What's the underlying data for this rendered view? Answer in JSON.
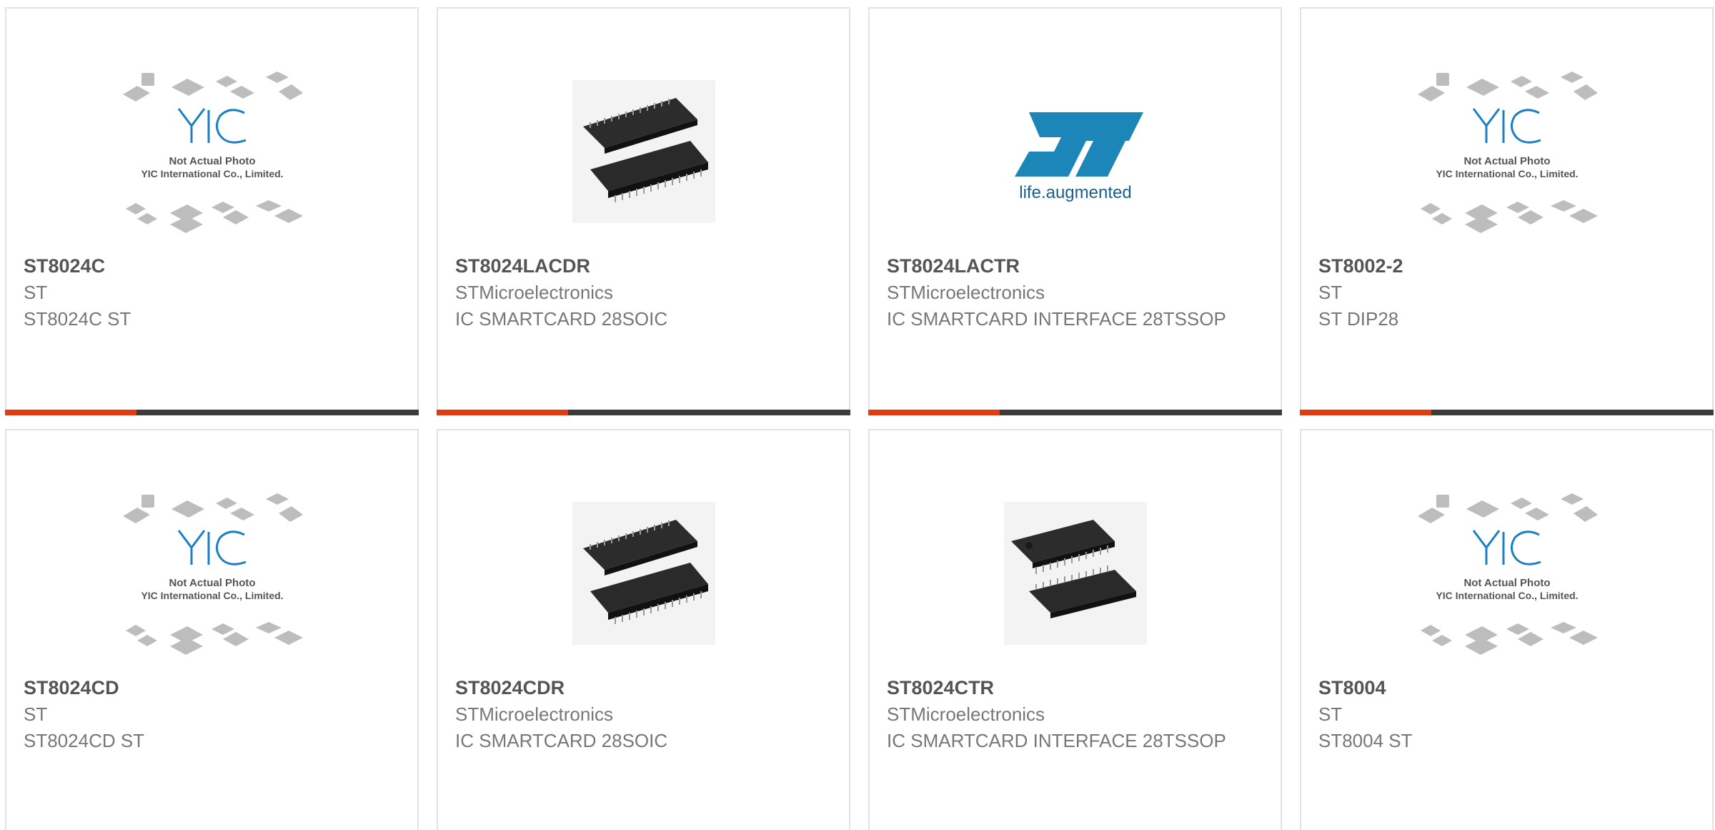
{
  "cards": [
    {
      "part": "ST8024C",
      "maker": "ST",
      "desc": "ST8024C ST",
      "image": "yic-placeholder"
    },
    {
      "part": "ST8024LACDR",
      "maker": "STMicroelectronics",
      "desc": "IC SMARTCARD 28SOIC",
      "image": "soic-chip-photo"
    },
    {
      "part": "ST8024LACTR",
      "maker": "STMicroelectronics",
      "desc": "IC SMARTCARD INTERFACE 28TSSOP",
      "image": "st-logo"
    },
    {
      "part": "ST8002-2",
      "maker": "ST",
      "desc": "ST DIP28",
      "image": "yic-placeholder"
    },
    {
      "part": "ST8024CD",
      "maker": "ST",
      "desc": "ST8024CD ST",
      "image": "yic-placeholder"
    },
    {
      "part": "ST8024CDR",
      "maker": "STMicroelectronics",
      "desc": "IC SMARTCARD 28SOIC",
      "image": "soic-chip-photo"
    },
    {
      "part": "ST8024CTR",
      "maker": "STMicroelectronics",
      "desc": "IC SMARTCARD INTERFACE 28TSSOP",
      "image": "tssop-chip-photo"
    },
    {
      "part": "ST8004",
      "maker": "ST",
      "desc": "ST8004 ST",
      "image": "yic-placeholder"
    }
  ],
  "placeholder": {
    "brand": "YIC",
    "line1": "Not Actual Photo",
    "line2": "YIC International Co., Limited."
  },
  "st_logo": {
    "text": "life.augmented"
  },
  "colors": {
    "accent": "#e03c12",
    "bar": "#3c3c3c",
    "st_blue": "#1d86b8",
    "yic_blue": "#1b7fc4"
  }
}
